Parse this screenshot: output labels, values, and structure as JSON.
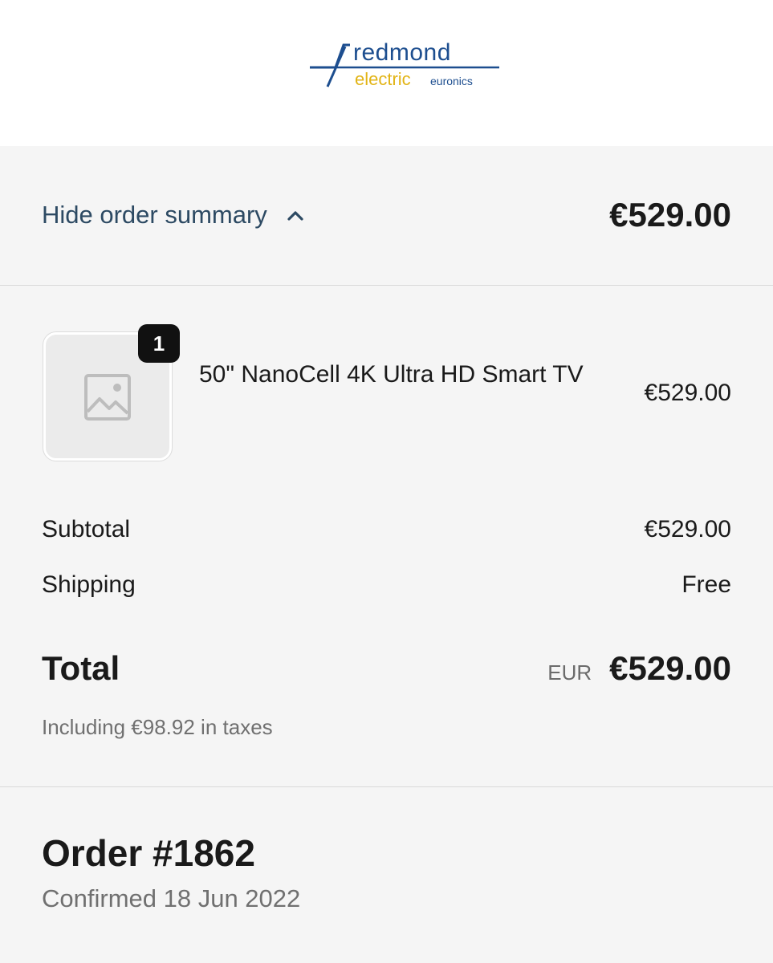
{
  "brand": {
    "name_top": "redmond",
    "name_bottom": "electric",
    "sub": "euronics",
    "colors": {
      "blue": "#1d4e8f",
      "yellow": "#e2b416"
    }
  },
  "summary_toggle": {
    "label": "Hide order summary",
    "icon": "chevron-up-icon",
    "total": "€529.00"
  },
  "line_items": [
    {
      "quantity": "1",
      "name": "50\" NanoCell 4K Ultra HD Smart TV",
      "price": "€529.00",
      "image_icon": "image-placeholder-icon"
    }
  ],
  "costs": {
    "subtotal_label": "Subtotal",
    "subtotal_value": "€529.00",
    "shipping_label": "Shipping",
    "shipping_value": "Free",
    "total_label": "Total",
    "currency": "EUR",
    "total_value": "€529.00",
    "taxes_note": "Including €98.92 in taxes"
  },
  "order": {
    "title": "Order #1862",
    "confirmed": "Confirmed 18 Jun 2022"
  }
}
